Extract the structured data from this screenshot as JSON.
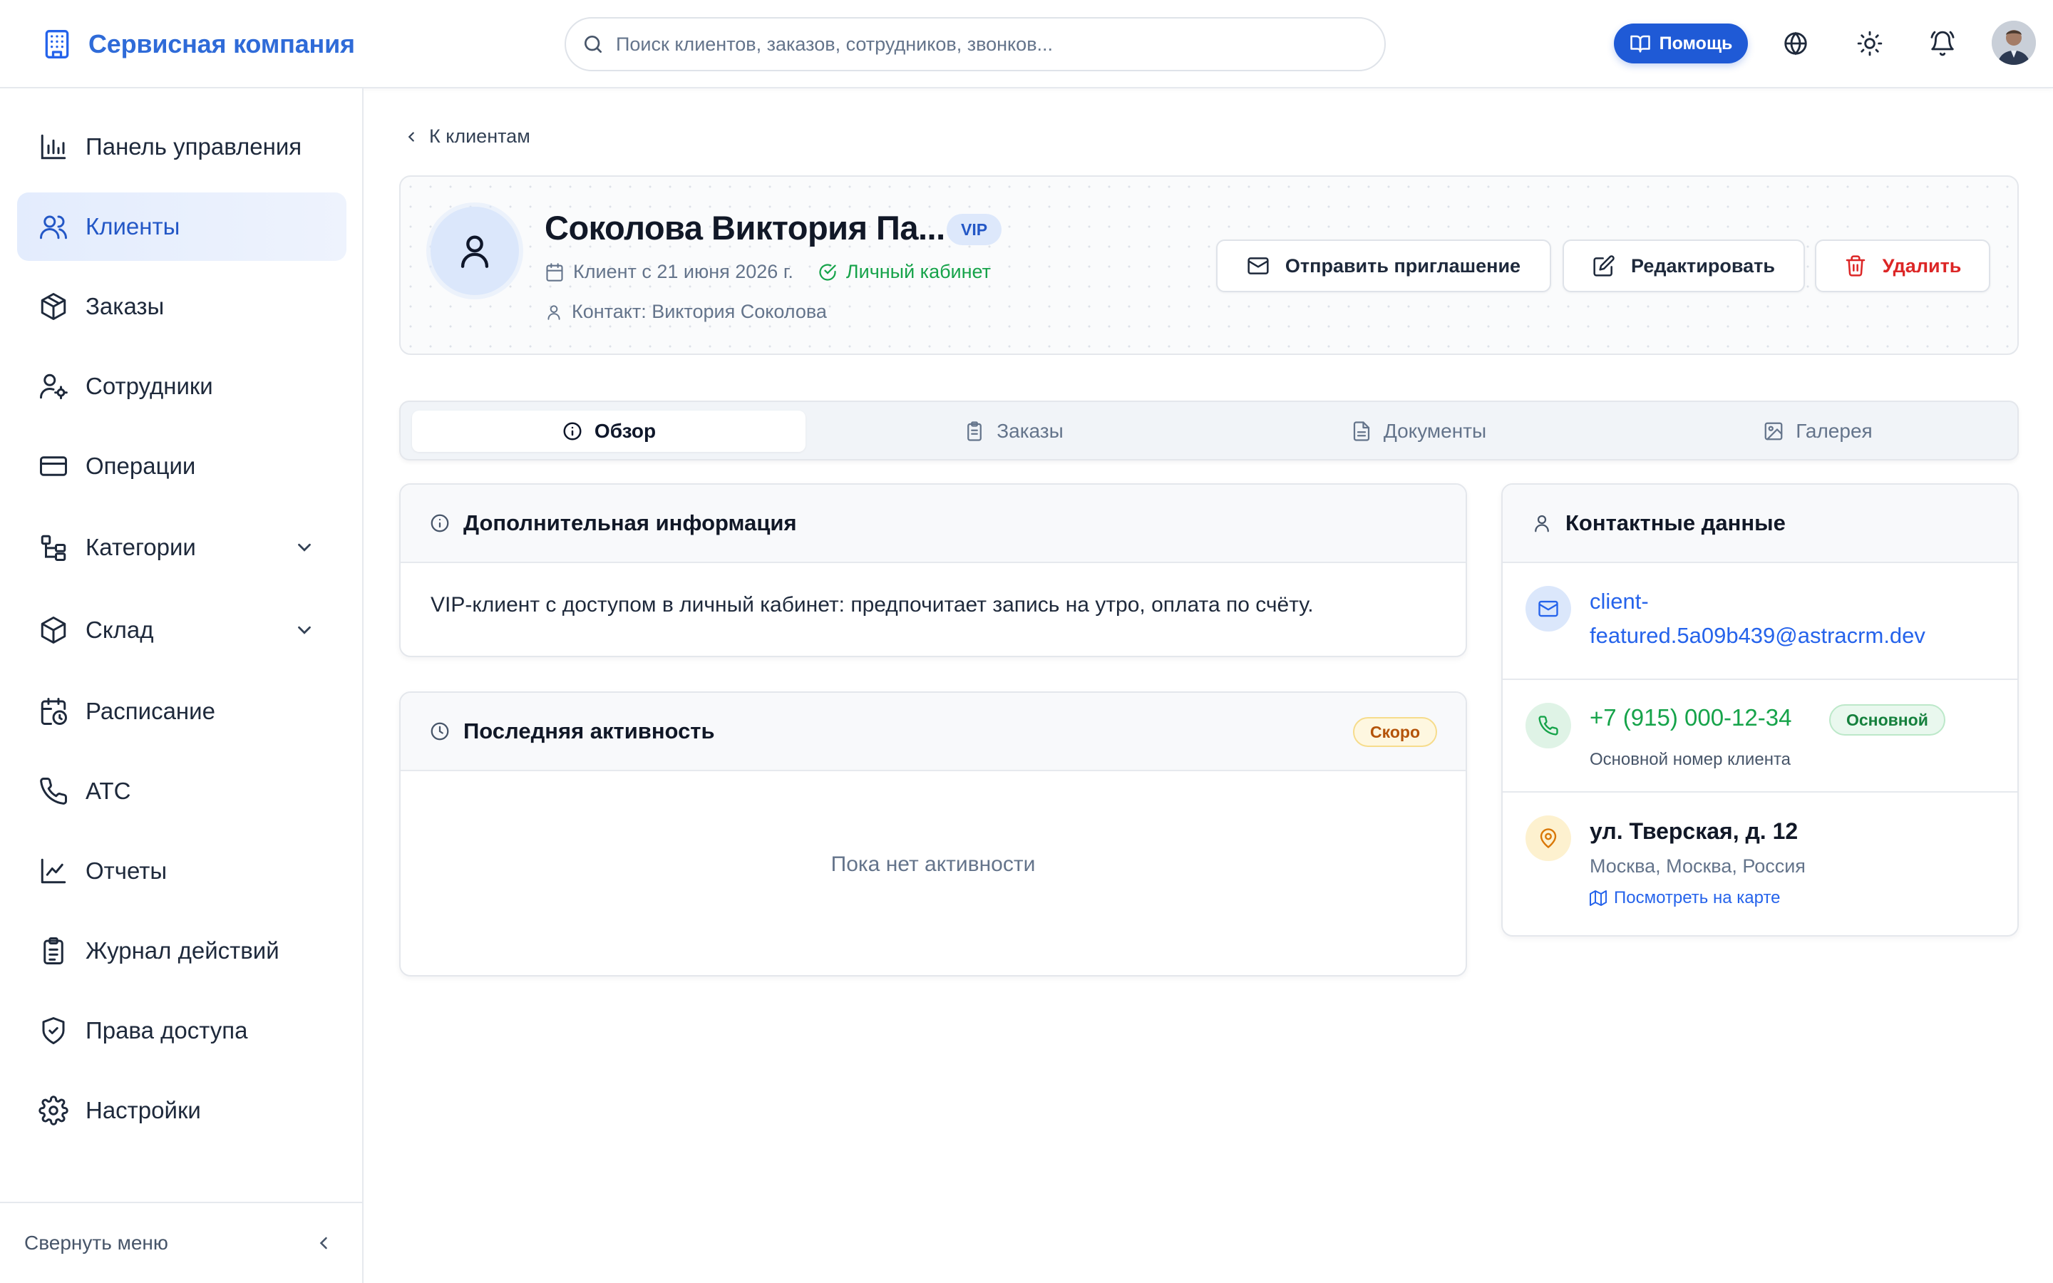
{
  "header": {
    "app_name": "Сервисная компания",
    "search_placeholder": "Поиск клиентов, заказов, сотрудников, звонков...",
    "help_label": "Помощь",
    "accent_color": "#1f5ad6"
  },
  "sidebar": {
    "items": [
      {
        "label": "Панель управления",
        "icon": "bar-chart-icon"
      },
      {
        "label": "Клиенты",
        "icon": "users-icon",
        "active": true
      },
      {
        "label": "Заказы",
        "icon": "package-icon"
      },
      {
        "label": "Сотрудники",
        "icon": "user-cog-icon"
      },
      {
        "label": "Операции",
        "icon": "credit-card-icon"
      },
      {
        "label": "Категории",
        "icon": "tree-icon",
        "expandable": true
      },
      {
        "label": "Склад",
        "icon": "box-icon",
        "expandable": true
      },
      {
        "label": "Расписание",
        "icon": "calendar-clock-icon"
      },
      {
        "label": "АТС",
        "icon": "phone-icon"
      },
      {
        "label": "Отчеты",
        "icon": "line-chart-icon"
      },
      {
        "label": "Журнал действий",
        "icon": "clipboard-icon"
      },
      {
        "label": "Права доступа",
        "icon": "shield-icon"
      },
      {
        "label": "Настройки",
        "icon": "gear-icon"
      }
    ],
    "collapse_label": "Свернуть меню"
  },
  "main": {
    "back_label": "К клиентам",
    "client": {
      "name": "Соколова Виктория Па...",
      "badge": "VIP",
      "since": "Клиент с 21 июня 2026 г.",
      "portal": "Личный кабинет",
      "contact": "Контакт: Виктория Соколова"
    },
    "actions": {
      "invite": "Отправить приглашение",
      "edit": "Редактировать",
      "delete": "Удалить"
    },
    "tabs": [
      {
        "label": "Обзор",
        "active": true
      },
      {
        "label": "Заказы"
      },
      {
        "label": "Документы"
      },
      {
        "label": "Галерея"
      }
    ],
    "info_card": {
      "title": "Дополнительная информация",
      "text": "VIP-клиент с доступом в личный кабинет: предпочитает запись на утро, оплата по счёту."
    },
    "activity_card": {
      "title": "Последняя активность",
      "badge": "Скоро",
      "empty": "Пока нет активности"
    },
    "contact_card": {
      "title": "Контактные данные",
      "email_line1": "client-",
      "email_line2": "featured.5a09b439@astracrm.dev",
      "phone": "+7 (915) 000-12-34",
      "phone_badge": "Основной",
      "phone_note": "Основной номер клиента",
      "address": "ул. Тверская, д. 12",
      "city": "Москва, Москва, Россия",
      "map_link": "Посмотреть на карте"
    }
  }
}
